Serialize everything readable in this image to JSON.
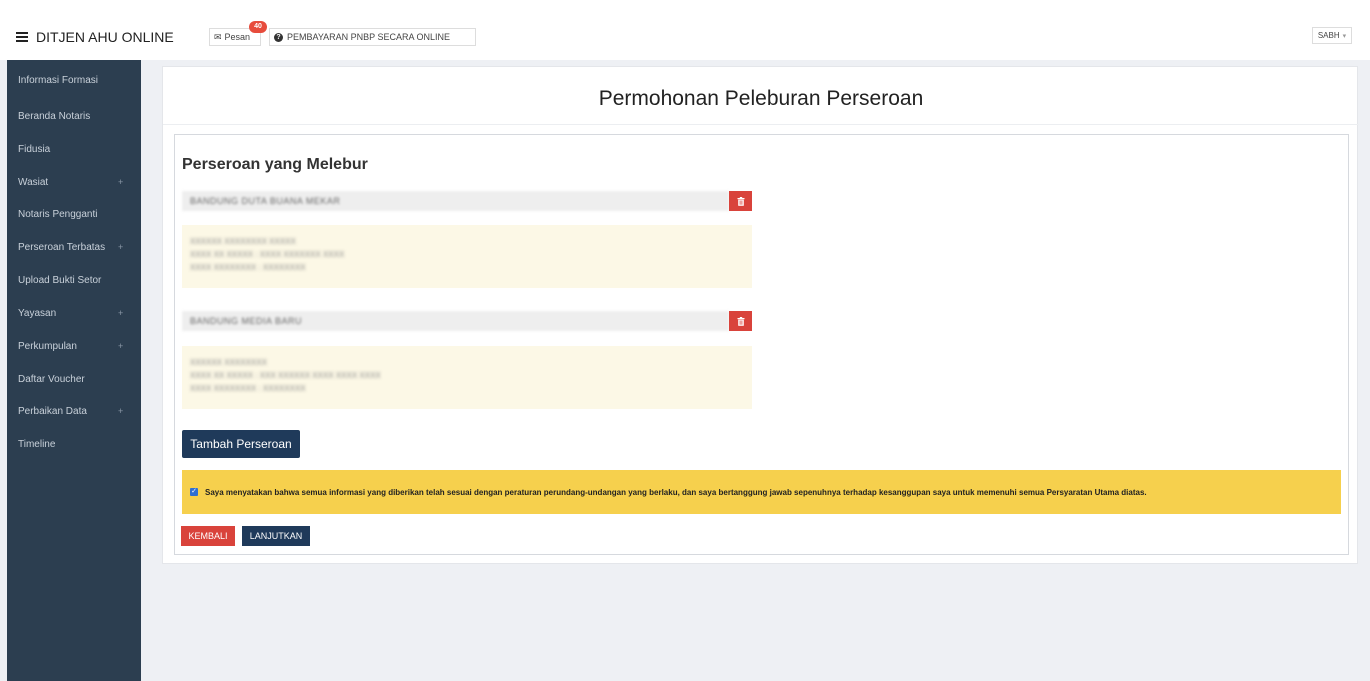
{
  "header": {
    "brand": "DITJEN AHU ONLINE",
    "pesan_label": "Pesan",
    "pesan_badge": "40",
    "pnbp_label": "PEMBAYARAN PNBP SECARA ONLINE",
    "user_label": "SABH"
  },
  "sidebar": {
    "items": [
      {
        "label": "Informasi Formasi",
        "expandable": false
      },
      {
        "label": "Beranda Notaris",
        "expandable": false
      },
      {
        "label": "Fidusia",
        "expandable": false
      },
      {
        "label": "Wasiat",
        "expandable": true
      },
      {
        "label": "Notaris Pengganti",
        "expandable": false
      },
      {
        "label": "Perseroan Terbatas",
        "expandable": true
      },
      {
        "label": "Upload Bukti Setor",
        "expandable": false
      },
      {
        "label": "Yayasan",
        "expandable": true
      },
      {
        "label": "Perkumpulan",
        "expandable": true
      },
      {
        "label": "Daftar Voucher",
        "expandable": false
      },
      {
        "label": "Perbaikan Data",
        "expandable": true
      },
      {
        "label": "Timeline",
        "expandable": false
      }
    ],
    "expand_symbol": "+"
  },
  "main": {
    "title": "Permohonan Peleburan Perseroan",
    "section_title": "Perseroan yang Melebur",
    "companies": [
      {
        "name": "BANDUNG DUTA BUANA MEKAR",
        "info_lines": [
          "XXXXXX XXXXXXXX XXXXX",
          "XXXX XX XXXXX : XXXX XXXXXXX XXXX",
          "XXXX XXXXXXXX : XXXXXXXX"
        ]
      },
      {
        "name": "BANDUNG MEDIA BARU",
        "info_lines": [
          "XXXXXX XXXXXXXX",
          "XXXX XX XXXXX : XXX XXXXXX XXXX XXXX XXXX",
          "XXXX XXXXXXXX : XXXXXXXX"
        ]
      }
    ],
    "delete_icon": "trash-icon",
    "add_button": "Tambah Perseroan",
    "agreement": "Saya menyatakan bahwa semua informasi yang diberikan telah sesuai dengan peraturan perundang-undangan yang berlaku, dan saya bertanggung jawab sepenuhnya terhadap kesanggupan saya untuk memenuhi semua Persyaratan Utama diatas.",
    "agreement_checked": true,
    "back_button": "KEMBALI",
    "next_button": "LANJUTKAN"
  },
  "colors": {
    "sidebar_bg": "#2c3e50",
    "primary": "#1f3a5a",
    "danger": "#d9433b",
    "agreement_bg": "#f6d04d",
    "info_bg": "#fcf8e6"
  }
}
